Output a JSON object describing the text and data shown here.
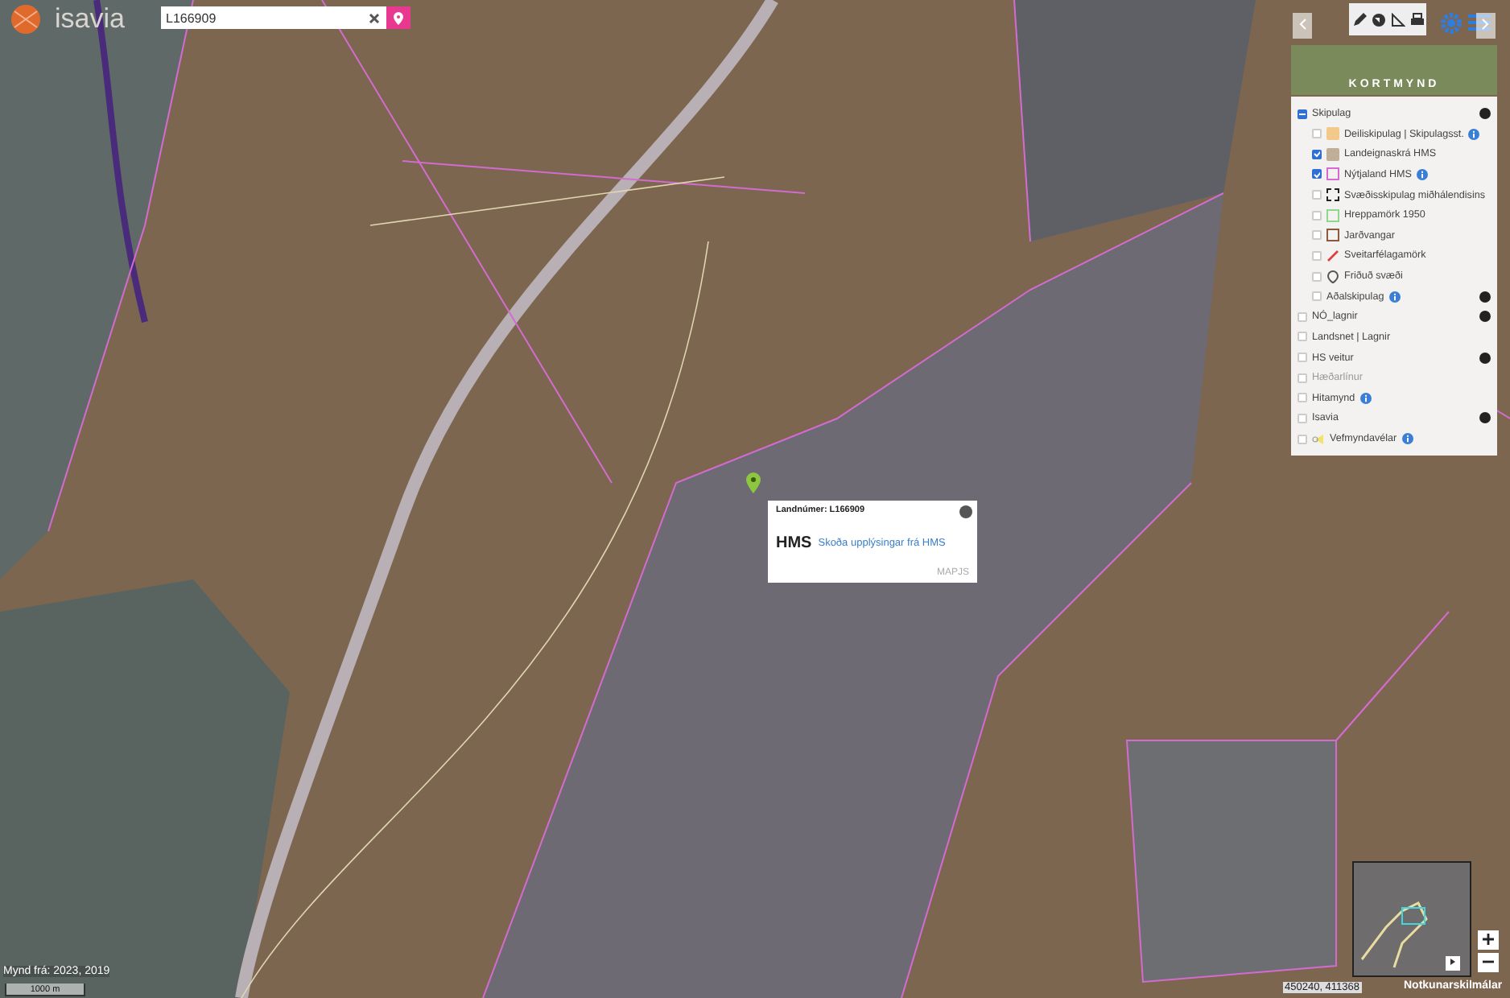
{
  "header": {
    "logo": "isavia",
    "search": {
      "value": "L166909"
    }
  },
  "basemap": {
    "label": "KORTMYND"
  },
  "layers": [
    {
      "label": "Skipulag",
      "checked": true,
      "expanded": true,
      "kind": "group",
      "children": [
        {
          "label": "Deiliskipulag | Skipulagsst.",
          "checked": false,
          "kind": "fill",
          "color": "#f2c98a",
          "info": true
        },
        {
          "label": "Landeignaskrá HMS",
          "checked": true,
          "kind": "fill",
          "color": "#bfae98",
          "info": false
        },
        {
          "label": "Nýtjaland HMS",
          "checked": true,
          "kind": "outline",
          "color": "#d36bd0",
          "info": true
        },
        {
          "label": "Svæðisskipulag miðhálendisins",
          "checked": false,
          "kind": "dashed",
          "color": "#222222",
          "info": false
        },
        {
          "label": "Hreppamörk 1950",
          "checked": false,
          "kind": "outline",
          "color": "#8fd78f",
          "info": false
        },
        {
          "label": "Jarðvangar",
          "checked": false,
          "kind": "outline",
          "color": "#8b5a3c",
          "info": false
        },
        {
          "label": "Sveitarfélagamörk",
          "checked": false,
          "kind": "line",
          "color": "#e03c3c",
          "info": false
        },
        {
          "label": "Friðuð svæði",
          "checked": false,
          "kind": "pin",
          "color": "#555555",
          "info": false
        },
        {
          "label": "Aðalskipulag",
          "checked": false,
          "kind": "plain",
          "info": true,
          "more": true
        }
      ]
    },
    {
      "label": "NÓ_lagnir",
      "checked": false,
      "kind": "layer",
      "more": true,
      "info": false
    },
    {
      "label": "Landsnet | Lagnir",
      "checked": false,
      "kind": "layer",
      "more": false,
      "info": false
    },
    {
      "label": "HS veitur",
      "checked": false,
      "kind": "layer",
      "more": true,
      "info": false
    },
    {
      "label": "Hæðarlínur",
      "checked": false,
      "kind": "layer",
      "more": false,
      "info": false,
      "disabled": true
    },
    {
      "label": "Hitamynd",
      "checked": false,
      "kind": "layer",
      "more": false,
      "info": true
    },
    {
      "label": "Isavia",
      "checked": false,
      "kind": "layer",
      "more": true,
      "info": false
    },
    {
      "label": "Vefmyndavélar",
      "checked": false,
      "kind": "camera",
      "more": false,
      "info": true
    }
  ],
  "popup": {
    "title": "Landnúmer: L166909",
    "brand": "HMS",
    "link": "Skoða upplýsingar frá HMS",
    "credit": "MAPJS"
  },
  "footer": {
    "photo_date": "Mynd frá: 2023, 2019",
    "scale": "1000 m",
    "coordinates": "450240, 411368",
    "terms": "Notkunarskilmálar"
  }
}
